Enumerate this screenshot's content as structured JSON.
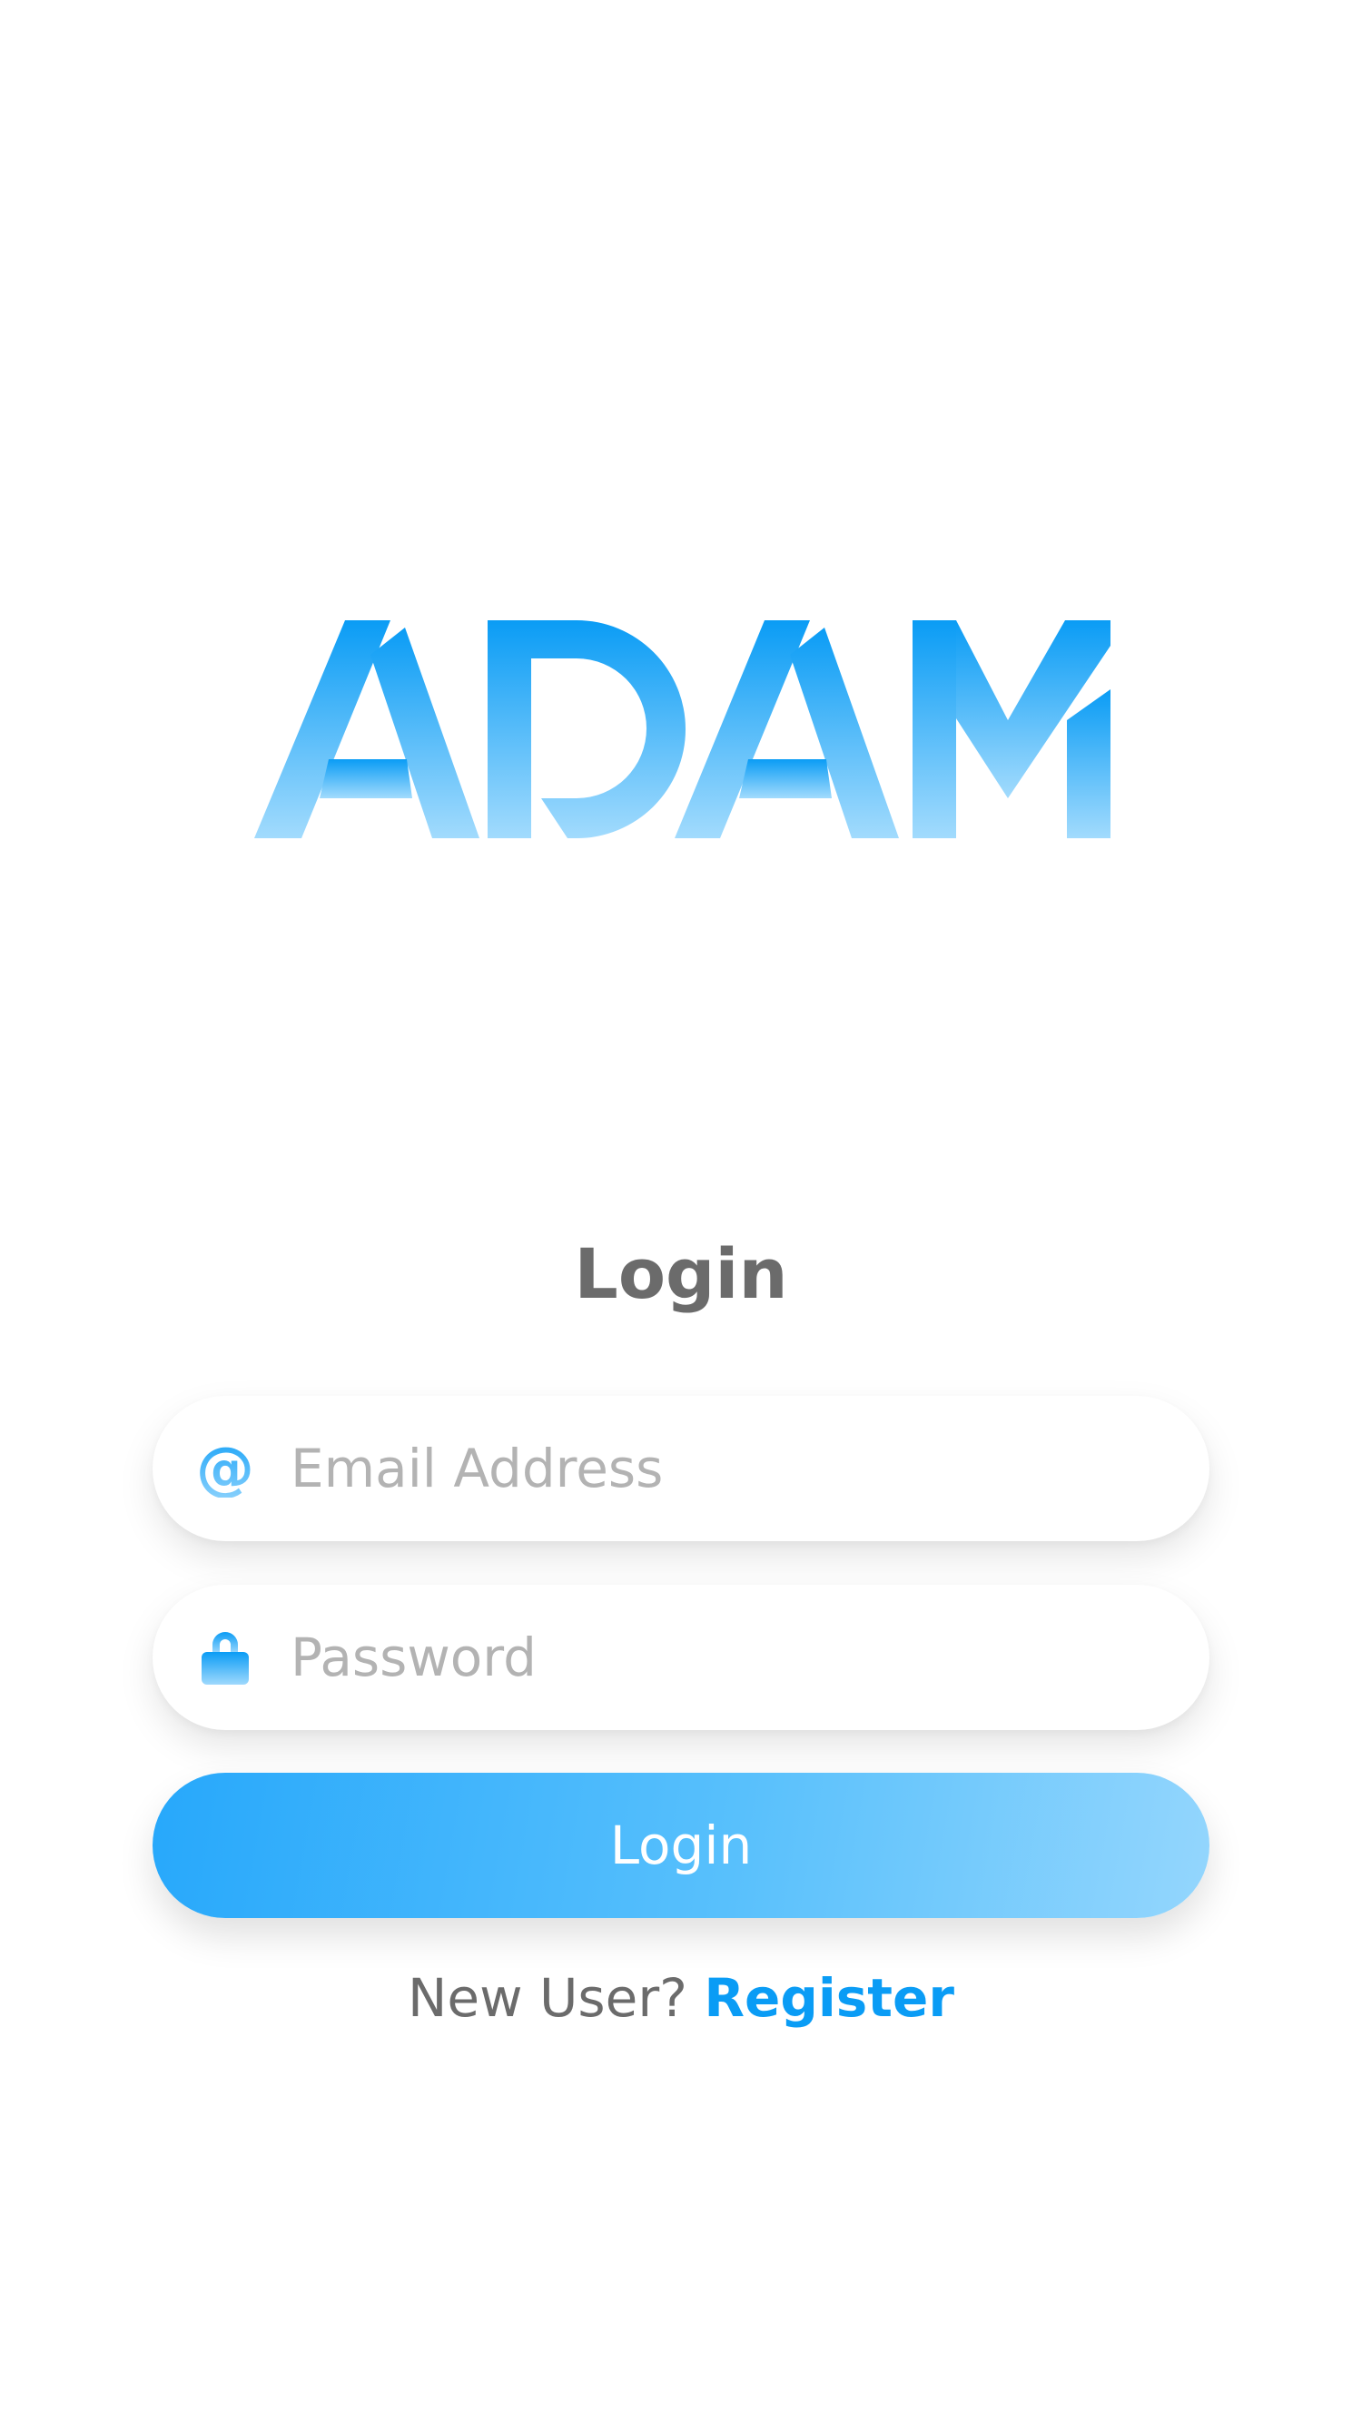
{
  "logo": {
    "text": "ADAM",
    "colors": {
      "top": "#0a9cf5",
      "bottom": "#a2dbfd"
    }
  },
  "title": "Login",
  "email": {
    "placeholder": "Email Address",
    "value": "",
    "icon": "at-icon"
  },
  "password": {
    "placeholder": "Password",
    "value": "",
    "icon": "lock-icon"
  },
  "login_button": {
    "label": "Login"
  },
  "register": {
    "prompt": "New User?",
    "link_label": "Register"
  },
  "colors": {
    "accent": "#0a9cf5",
    "button_gradient_start": "#27a8fb",
    "button_gradient_end": "#94d6fd",
    "title_text": "#6b6b6b",
    "placeholder": "#b3b3b3"
  }
}
